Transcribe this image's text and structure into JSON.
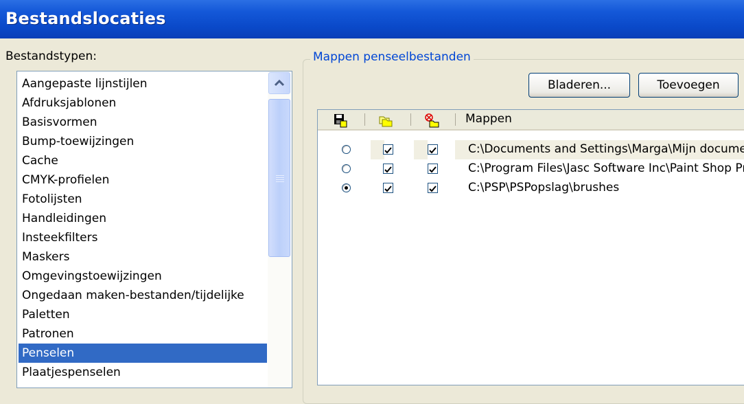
{
  "window": {
    "title": "Bestandslocaties"
  },
  "left_panel": {
    "label": "Bestandstypen:",
    "items": [
      "Aangepaste lijnstijlen",
      "Afdruksjablonen",
      "Basisvormen",
      "Bump-toewijzingen",
      "Cache",
      "CMYK-profielen",
      "Fotolijsten",
      "Handleidingen",
      "Insteekfilters",
      "Maskers",
      "Omgevingstoewijzingen",
      "Ongedaan maken-bestanden/tijdelijke",
      "Paletten",
      "Patronen",
      "Penselen",
      "Plaatjespenselen"
    ],
    "selected_index": 14
  },
  "right_panel": {
    "group_title": "Mappen penseelbestanden",
    "buttons": {
      "browse": "Bladeren...",
      "add": "Toevoegen"
    },
    "table": {
      "columns": {
        "save": "save-folder-icon",
        "enabled": "open-folders-icon",
        "subfolders": "disabled-folder-icon",
        "folders": "Mappen"
      },
      "rows": [
        {
          "default": false,
          "enabled": true,
          "subfolders": true,
          "path": "C:\\Documents and Settings\\Marga\\Mijn documenten"
        },
        {
          "default": false,
          "enabled": true,
          "subfolders": true,
          "path": "C:\\Program Files\\Jasc Software Inc\\Paint Shop Pro"
        },
        {
          "default": true,
          "enabled": true,
          "subfolders": true,
          "path": "C:\\PSP\\PSPopslag\\brushes"
        }
      ]
    }
  },
  "colors": {
    "selection": "#316ac5",
    "titlebar": "#0a49c9",
    "group_title": "#0046d5"
  }
}
